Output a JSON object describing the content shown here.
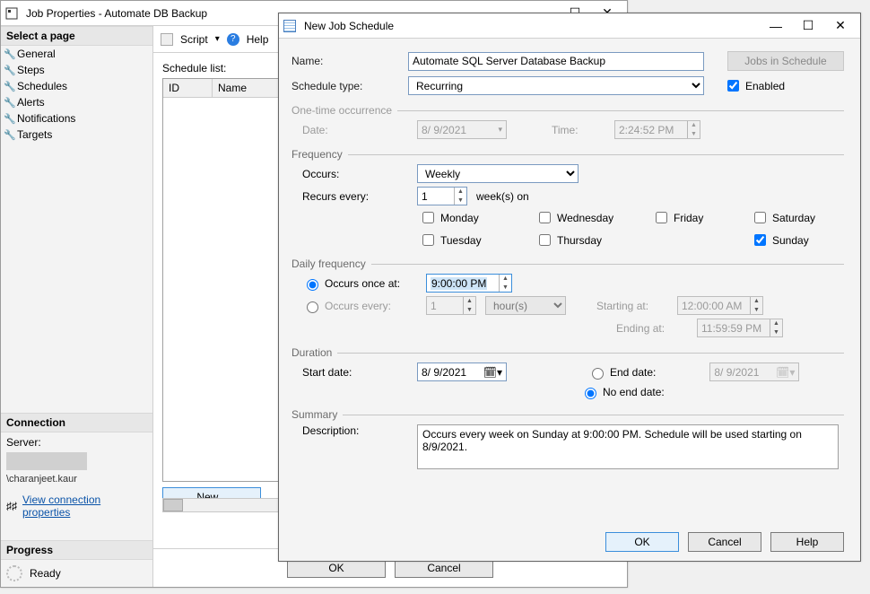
{
  "jobprops": {
    "title": "Job Properties - Automate DB Backup",
    "select_page": "Select a page",
    "pages": [
      "General",
      "Steps",
      "Schedules",
      "Alerts",
      "Notifications",
      "Targets"
    ],
    "connection_hdr": "Connection",
    "server_lbl": "Server:",
    "user": "\\charanjeet.kaur",
    "view_conn": "View connection properties",
    "progress_hdr": "Progress",
    "progress_status": "Ready",
    "script": "Script",
    "help": "Help",
    "schedule_list": "Schedule list:",
    "cols": {
      "id": "ID",
      "name": "Name"
    },
    "new_btn": "New...",
    "ok": "OK",
    "cancel": "Cancel"
  },
  "newjob": {
    "title": "New Job Schedule",
    "name_lbl": "Name:",
    "name_val": "Automate SQL Server Database Backup",
    "jobs_in_schedule": "Jobs in Schedule",
    "schedule_type_lbl": "Schedule type:",
    "schedule_type_val": "Recurring",
    "enabled_lbl": "Enabled",
    "enabled": true,
    "onetime_hdr": "One-time occurrence",
    "date_lbl": "Date:",
    "date_val": "8/  9/2021",
    "time_lbl": "Time:",
    "time_val": "2:24:52 PM",
    "freq_hdr": "Frequency",
    "occurs_lbl": "Occurs:",
    "occurs_val": "Weekly",
    "recurs_lbl": "Recurs every:",
    "recurs_val": "1",
    "weeks_on": "week(s) on",
    "days": {
      "mon": "Monday",
      "tue": "Tuesday",
      "wed": "Wednesday",
      "thu": "Thursday",
      "fri": "Friday",
      "sat": "Saturday",
      "sun": "Sunday"
    },
    "daily_hdr": "Daily frequency",
    "once_lbl": "Occurs once at:",
    "once_val": "9:00:00 PM",
    "every_lbl": "Occurs every:",
    "every_num": "1",
    "every_unit": "hour(s)",
    "starting_lbl": "Starting at:",
    "starting_val": "12:00:00 AM",
    "ending_lbl": "Ending at:",
    "ending_val": "11:59:59 PM",
    "duration_hdr": "Duration",
    "start_date_lbl": "Start date:",
    "start_date_val": "8/  9/2021",
    "end_date_lbl": "End date:",
    "end_date_val": "8/  9/2021",
    "no_end_lbl": "No end date:",
    "summary_hdr": "Summary",
    "desc_lbl": "Description:",
    "desc_val": "Occurs every week on Sunday at 9:00:00 PM. Schedule will be used starting on 8/9/2021.",
    "ok": "OK",
    "cancel": "Cancel",
    "help": "Help"
  }
}
